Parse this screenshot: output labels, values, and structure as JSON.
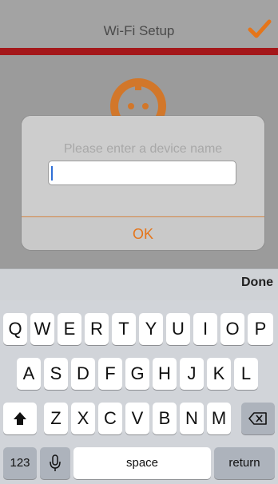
{
  "header": {
    "title": "Wi-Fi Setup"
  },
  "icons": {
    "confirm": "checkmark-icon",
    "device": "power-plug-icon",
    "shift": "shift-arrow-icon",
    "backspace": "backspace-icon",
    "mic": "microphone-icon"
  },
  "colors": {
    "accent": "#e5751a",
    "bar": "#a4171a"
  },
  "dialog": {
    "prompt": "Please enter a device name",
    "input_value": "",
    "ok_label": "OK"
  },
  "keyboard": {
    "done_label": "Done",
    "row1": [
      "Q",
      "W",
      "E",
      "R",
      "T",
      "Y",
      "U",
      "I",
      "O",
      "P"
    ],
    "row2": [
      "A",
      "S",
      "D",
      "F",
      "G",
      "H",
      "J",
      "K",
      "L"
    ],
    "row3": [
      "Z",
      "X",
      "C",
      "V",
      "B",
      "N",
      "M"
    ],
    "num_label": "123",
    "space_label": "space",
    "return_label": "return"
  }
}
